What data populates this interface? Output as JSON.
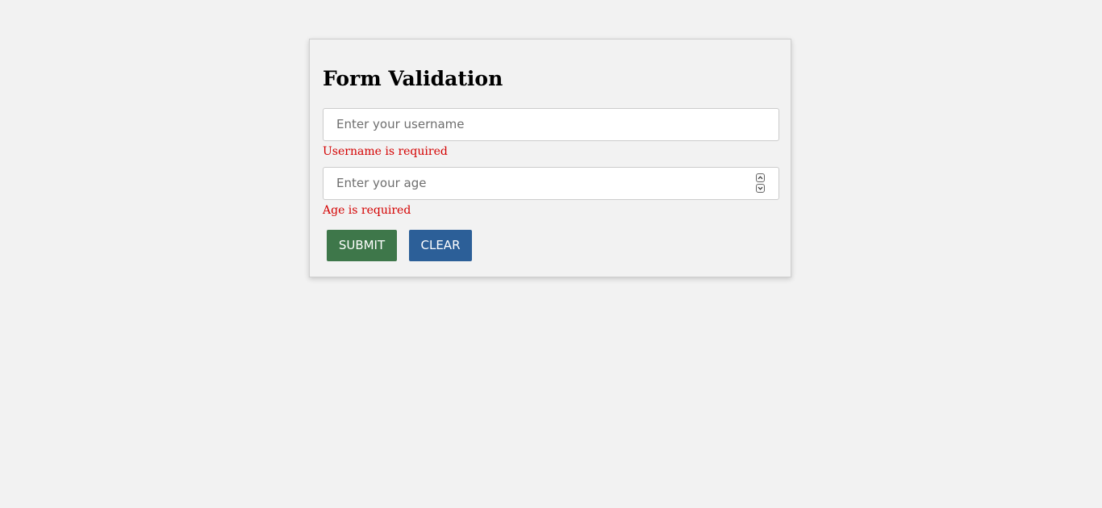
{
  "form": {
    "title": "Form Validation",
    "username": {
      "value": "",
      "placeholder": "Enter your username",
      "error": "Username is required"
    },
    "age": {
      "value": "",
      "placeholder": "Enter your age",
      "error": "Age is required"
    },
    "buttons": {
      "submit_label": "SUBMIT",
      "clear_label": "CLEAR"
    }
  },
  "icons": {
    "spinner_up": "chevron-up-icon",
    "spinner_down": "chevron-down-icon"
  },
  "colors": {
    "page_background": "#f2f2f2",
    "error_text": "#d40000",
    "submit_button": "#3e774a",
    "clear_button": "#2c5f98"
  }
}
